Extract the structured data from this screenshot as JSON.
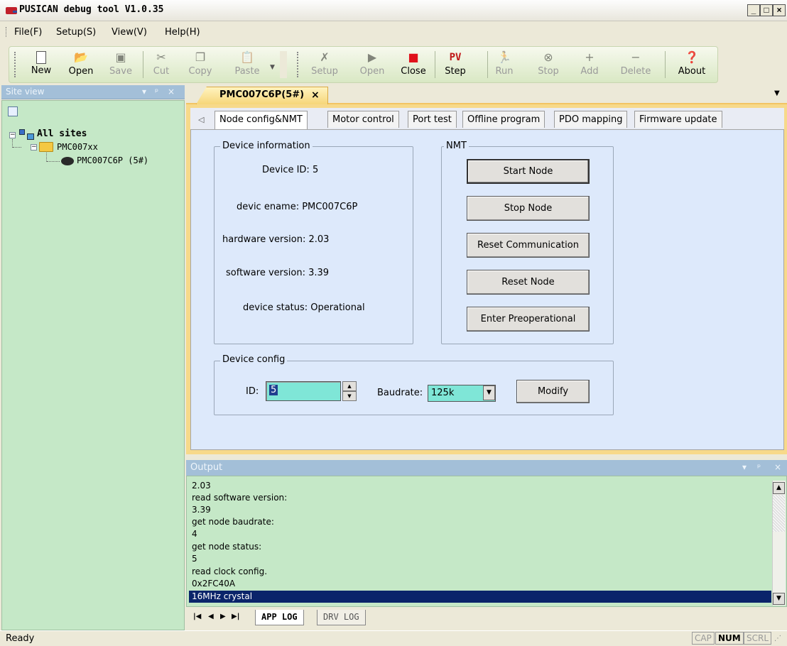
{
  "window": {
    "title": "PUSICAN debug tool V1.0.35",
    "controls": [
      "_",
      "□",
      "×"
    ]
  },
  "menu": [
    "File(F)",
    "Setup(S)",
    "View(V)",
    "Help(H)"
  ],
  "toolbar": {
    "new": "New",
    "open": "Open",
    "save": "Save",
    "cut": "Cut",
    "copy": "Copy",
    "paste": "Paste",
    "setup": "Setup",
    "open2": "Open",
    "close": "Close",
    "step": "Step",
    "step_icon": "PV",
    "run": "Run",
    "stop": "Stop",
    "add": "Add",
    "delete": "Delete",
    "about": "About"
  },
  "site_view": {
    "title": "Site view",
    "controls": [
      "▾",
      "ᵖ",
      "×"
    ],
    "tree": {
      "root": "All sites",
      "group": "PMC007xx",
      "device": "PMC007C6P (5#)"
    }
  },
  "document_tab": {
    "label": "PMC007C6P(5#)",
    "close": "×"
  },
  "inner_tabs": [
    "Node config&NMT",
    "Motor control",
    "Port test",
    "Offline program",
    "PDO mapping",
    "Firmware update"
  ],
  "device_information": {
    "title": "Device information",
    "device_id": "Device ID: 5",
    "device_name": "devic ename: PMC007C6P",
    "hardware_version": "hardware version: 2.03",
    "software_version": "software version: 3.39",
    "device_status": "device status: Operational"
  },
  "nmt": {
    "title": "NMT",
    "start_node": "Start Node",
    "stop_node": "Stop Node",
    "reset_communication": "Reset Communication",
    "reset_node": "Reset Node",
    "enter_preoperational": "Enter Preoperational"
  },
  "device_config": {
    "title": "Device config",
    "id_label": "ID:",
    "id_value": "5",
    "baudrate_label": "Baudrate:",
    "baudrate_value": "125k",
    "modify": "Modify"
  },
  "output": {
    "title": "Output",
    "controls": [
      "▾",
      "ᵖ",
      "×"
    ],
    "lines": [
      "2.03",
      "read software version:",
      "3.39",
      "get node baudrate:",
      "4",
      "get node status:",
      "5",
      "read clock config.",
      "0x2FC40A",
      "16MHz crystal"
    ],
    "selected_index": 9,
    "tabs": [
      "APP LOG",
      "DRV LOG"
    ]
  },
  "status": {
    "text": "Ready",
    "indicators": [
      "CAP",
      "NUM",
      "SCRL"
    ]
  },
  "colors": {
    "panel_green": "#c5e8c7",
    "tab_panel": "#dde9fb",
    "pane_header": "#a3bfd8",
    "doc_tab": "#f6d679",
    "input_cyan": "#7fe6d7",
    "selection": "#0a246a",
    "close_red": "#e0101a"
  }
}
